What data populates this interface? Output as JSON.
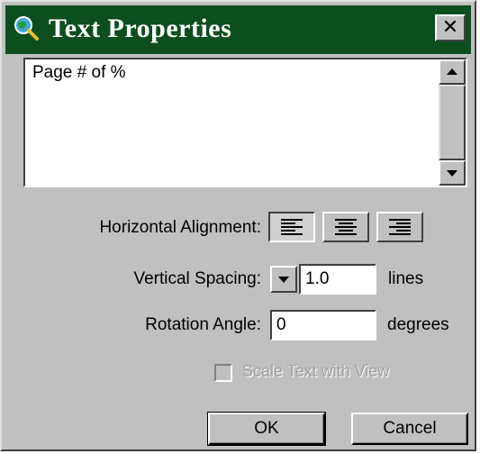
{
  "window": {
    "title": "Text Properties",
    "close_glyph": "✕",
    "title_bar_color": "#0d4e1f",
    "icon": "magnifier-globe-icon"
  },
  "text_area": {
    "value": "Page # of %"
  },
  "alignment": {
    "label": "Horizontal Alignment:",
    "options": [
      "left",
      "center",
      "right"
    ],
    "selected": "left"
  },
  "spacing": {
    "label": "Vertical Spacing:",
    "value": "1.0",
    "unit": "lines"
  },
  "rotation": {
    "label": "Rotation Angle:",
    "value": "0",
    "unit": "degrees"
  },
  "scale_text": {
    "label": "Scale Text with View",
    "checked": false,
    "enabled": false
  },
  "buttons": {
    "ok": "OK",
    "cancel": "Cancel"
  }
}
